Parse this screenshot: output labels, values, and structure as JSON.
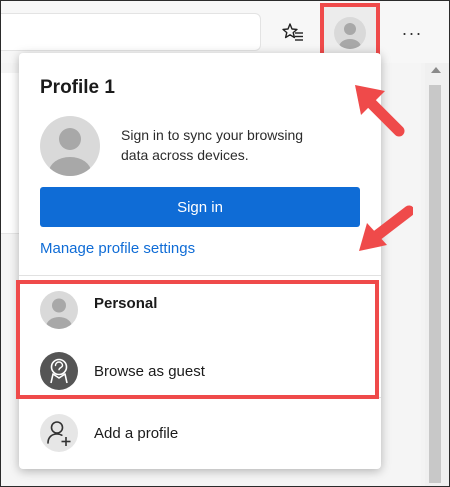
{
  "toolbar": {
    "favorites_icon": "favorites-star-icon",
    "profile_icon": "profile-avatar-icon",
    "more_label": "···"
  },
  "flyout": {
    "title": "Profile 1",
    "sync_text": "Sign in to sync your browsing data across devices.",
    "signin_label": "Sign in",
    "manage_label": "Manage profile settings",
    "profiles": [
      {
        "label": "Personal",
        "icon": "person-avatar-icon"
      },
      {
        "label": "Browse as guest",
        "icon": "guest-icon"
      }
    ],
    "add_profile_label": "Add a profile",
    "add_profile_icon": "add-person-icon"
  },
  "colors": {
    "accent": "#0f6cd6",
    "highlight": "#ef4a4a",
    "avatar_bg": "#d9d9d9",
    "avatar_fg": "#a8a8a8",
    "guest_bg": "#555555"
  }
}
